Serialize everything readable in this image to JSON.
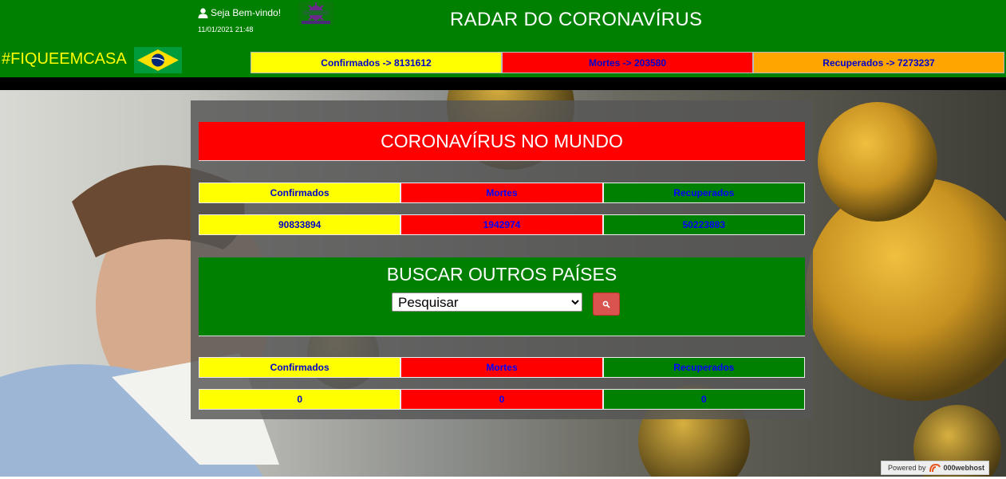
{
  "header": {
    "welcome": "Seja Bem-vindo!",
    "datetime": "11/01/2021 21:48",
    "title": "RADAR DO CORONAVÍRUS",
    "hashtag": "#FIQUEEMCASA",
    "stats": {
      "confirmed": "Confirmados -> 8131612",
      "deaths": "Mortes -> 203580",
      "recovered": "Recuperados -> 7273237"
    }
  },
  "world": {
    "title": "CORONAVÍRUS NO MUNDO",
    "labels": {
      "confirmed": "Confirmados",
      "deaths": "Mortes",
      "recovered": "Recuperados"
    },
    "values": {
      "confirmed": "90833894",
      "deaths": "1942974",
      "recovered": "50223883"
    }
  },
  "search": {
    "title": "BUSCAR OUTROS PAÍSES",
    "selected": "Pesquisar"
  },
  "country": {
    "labels": {
      "confirmed": "Confirmados",
      "deaths": "Mortes",
      "recovered": "Recuperados"
    },
    "values": {
      "confirmed": "0",
      "deaths": "0",
      "recovered": "0"
    }
  },
  "footer": {
    "powered_by": "Powered by",
    "host": "000webhost"
  },
  "colors": {
    "header": "#008000",
    "confirmed": "#ffff00",
    "deaths": "#ff0000",
    "recovered": "#008000",
    "recovered_top": "#ffa500",
    "value_text": "#0000ff"
  },
  "icons": [
    "user-icon",
    "search-icon",
    "brazil-flag-icon",
    "virus-logo-icon",
    "webhost-logo-icon"
  ]
}
